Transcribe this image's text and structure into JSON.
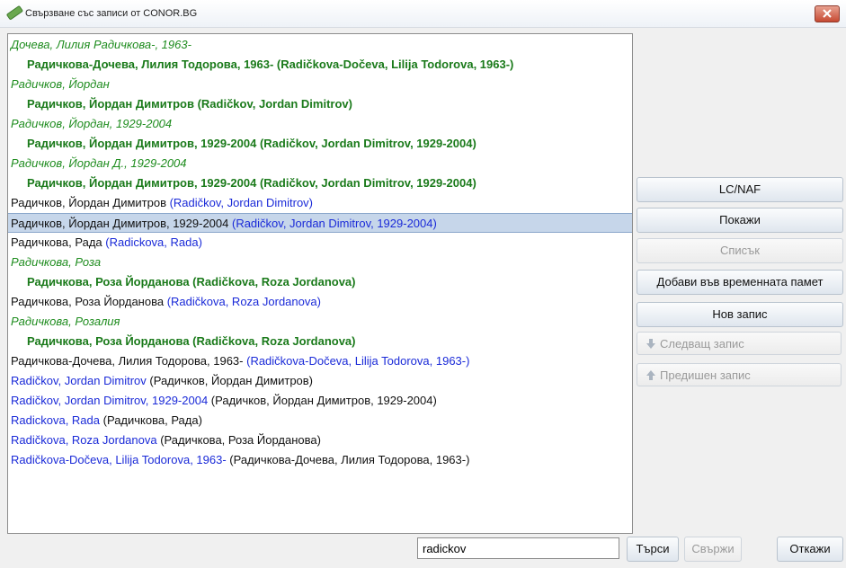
{
  "window": {
    "title": "Свързване със записи от CONOR.BG"
  },
  "list": [
    {
      "type": "alt",
      "text": "Дочева, Лилия Радичкова-, 1963-"
    },
    {
      "type": "main",
      "text": "Радичкова-Дочева, Лилия Тодорова, 1963- (Radičkova-Dočeva, Lilija Todorova, 1963-)"
    },
    {
      "type": "alt",
      "text": "Радичков, Йордан"
    },
    {
      "type": "main",
      "text": "Радичков, Йордан Димитров (Radičkov, Jordan Dimitrov)"
    },
    {
      "type": "alt",
      "text": "Радичков, Йордан, 1929-2004"
    },
    {
      "type": "main",
      "text": "Радичков, Йордан Димитров, 1929-2004 (Radičkov, Jordan Dimitrov, 1929-2004)"
    },
    {
      "type": "alt",
      "text": "Радичков, Йордан Д., 1929-2004"
    },
    {
      "type": "main",
      "text": "Радичков, Йордан Димитров, 1929-2004 (Radičkov, Jordan Dimitrov, 1929-2004)"
    },
    {
      "type": "plain",
      "a": "Радичков, Йордан Димитров ",
      "b": "(Radičkov, Jordan Dimitrov)",
      "a_color": "black",
      "b_color": "blue"
    },
    {
      "type": "plain",
      "a": "Радичков, Йордан Димитров, 1929-2004 ",
      "b": "(Radičkov, Jordan Dimitrov, 1929-2004)",
      "a_color": "black",
      "b_color": "blue",
      "selected": true
    },
    {
      "type": "plain",
      "a": "Радичкова, Рада ",
      "b": "(Radickova, Rada)",
      "a_color": "black",
      "b_color": "blue"
    },
    {
      "type": "alt",
      "text": "Радичкова, Роза"
    },
    {
      "type": "main",
      "text": "Радичкова, Роза Йорданова (Radičkova, Roza Jordanova)"
    },
    {
      "type": "plain",
      "a": "Радичкова, Роза Йорданова ",
      "b": "(Radičkova, Roza Jordanova)",
      "a_color": "black",
      "b_color": "blue"
    },
    {
      "type": "alt",
      "text": "Радичкова, Розалия"
    },
    {
      "type": "main",
      "text": "Радичкова, Роза Йорданова (Radičkova, Roza Jordanova)"
    },
    {
      "type": "plain",
      "a": "Радичкова-Дочева, Лилия Тодорова, 1963- ",
      "b": "(Radičkova-Dočeva, Lilija Todorova, 1963-)",
      "a_color": "black",
      "b_color": "blue"
    },
    {
      "type": "plain",
      "a": "Radičkov, Jordan Dimitrov ",
      "b": "(Радичков, Йордан Димитров)",
      "a_color": "blue",
      "b_color": "black"
    },
    {
      "type": "plain",
      "a": "Radičkov, Jordan Dimitrov, 1929-2004 ",
      "b": "(Радичков, Йордан Димитров, 1929-2004)",
      "a_color": "blue",
      "b_color": "black"
    },
    {
      "type": "plain",
      "a": "Radickova, Rada ",
      "b": "(Радичкова, Рада)",
      "a_color": "blue",
      "b_color": "black"
    },
    {
      "type": "plain",
      "a": "Radičkova, Roza Jordanova ",
      "b": "(Радичкова, Роза Йорданова)",
      "a_color": "blue",
      "b_color": "black"
    },
    {
      "type": "plain",
      "a": "Radičkova-Dočeva, Lilija Todorova, 1963- ",
      "b": "(Радичкова-Дочева, Лилия Тодорова, 1963-)",
      "a_color": "blue",
      "b_color": "black"
    }
  ],
  "side_buttons": {
    "lcnaf": "LC/NAF",
    "show": "Покажи",
    "list": "Списък",
    "add_temp": "Добави във временната памет",
    "new_record": "Нов запис",
    "next_record": "Следващ запис",
    "prev_record": "Предишен запис"
  },
  "bottom": {
    "search_value": "radickov",
    "search_button": "Търси",
    "link_button": "Свържи",
    "cancel_button": "Откажи"
  },
  "colors": {
    "green_alt": "#1e8c1e",
    "green_main": "#1a7a1a",
    "blue": "#1a2ad8",
    "selection": "#c6d6ea"
  }
}
